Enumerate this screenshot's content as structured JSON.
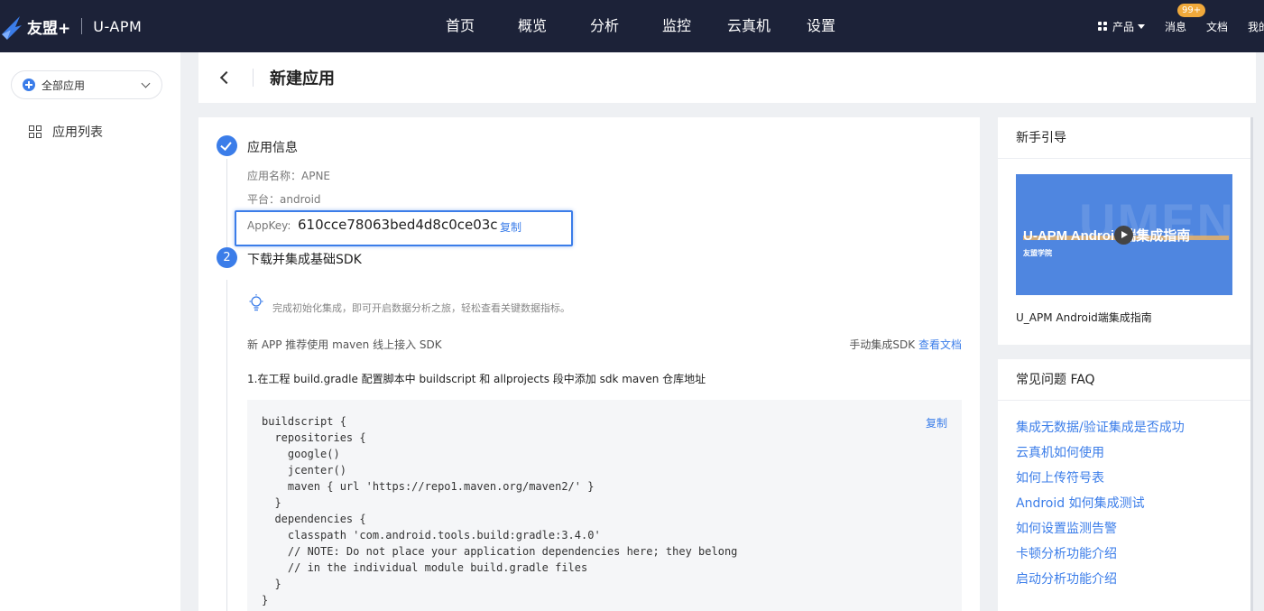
{
  "topbar": {
    "brand": "友盟+",
    "product": "U-APM",
    "nav": [
      "首页",
      "概览",
      "分析",
      "监控",
      "云真机",
      "设置"
    ],
    "products_label": "产品",
    "messages_label": "消息",
    "messages_badge": "99+",
    "docs_label": "文档",
    "me_label": "我的"
  },
  "sidebar": {
    "app_select": "全部应用",
    "items": [
      {
        "label": "应用列表"
      }
    ]
  },
  "header": {
    "title": "新建应用"
  },
  "main": {
    "step1": {
      "title": "应用信息",
      "app_name": "应用名称：APNE",
      "platform": "平台：android",
      "appkey_label": "AppKey:",
      "appkey_value": "610cce78063bed4d8c0ce03c",
      "copy_label": "复制"
    },
    "step2": {
      "number": "2",
      "title": "下载并集成基础SDK",
      "tip": "完成初始化集成，即可开启数据分析之旅，轻松查看关键数据指标。",
      "recommend": "新 APP 推荐使用 maven 线上接入 SDK",
      "manual_prefix": "手动集成SDK",
      "manual_link": "查看文档",
      "instruction": "1.在工程 build.gradle 配置脚本中 buildscript 和 allprojects 段中添加 sdk maven 仓库地址",
      "code": "buildscript {\n  repositories {\n    google()\n    jcenter()\n    maven { url 'https://repo1.maven.org/maven2/' }\n  }\n  dependencies {\n    classpath 'com.android.tools.build:gradle:3.4.0'\n    // NOTE: Do not place your application dependencies here; they belong\n    // in the individual module build.gradle files\n  }\n}",
      "copy_label": "复制"
    }
  },
  "guide": {
    "title": "新手引导",
    "video_title": "U-APM Android端集成指南",
    "video_watermark": "UMEN",
    "video_sub": "友盟学院",
    "caption": "U_APM Android端集成指南"
  },
  "faq": {
    "title": "常见问题 FAQ",
    "items": [
      "集成无数据/验证集成是否成功",
      "云真机如何使用",
      "如何上传符号表",
      "Android 如何集成测试",
      "如何设置监测告警",
      "卡顿分析功能介绍",
      "启动分析功能介绍"
    ]
  },
  "colors": {
    "topbar": "#1c2238",
    "accent": "#3b7de9",
    "badge": "#f0a93b",
    "background": "#eef0f3"
  }
}
